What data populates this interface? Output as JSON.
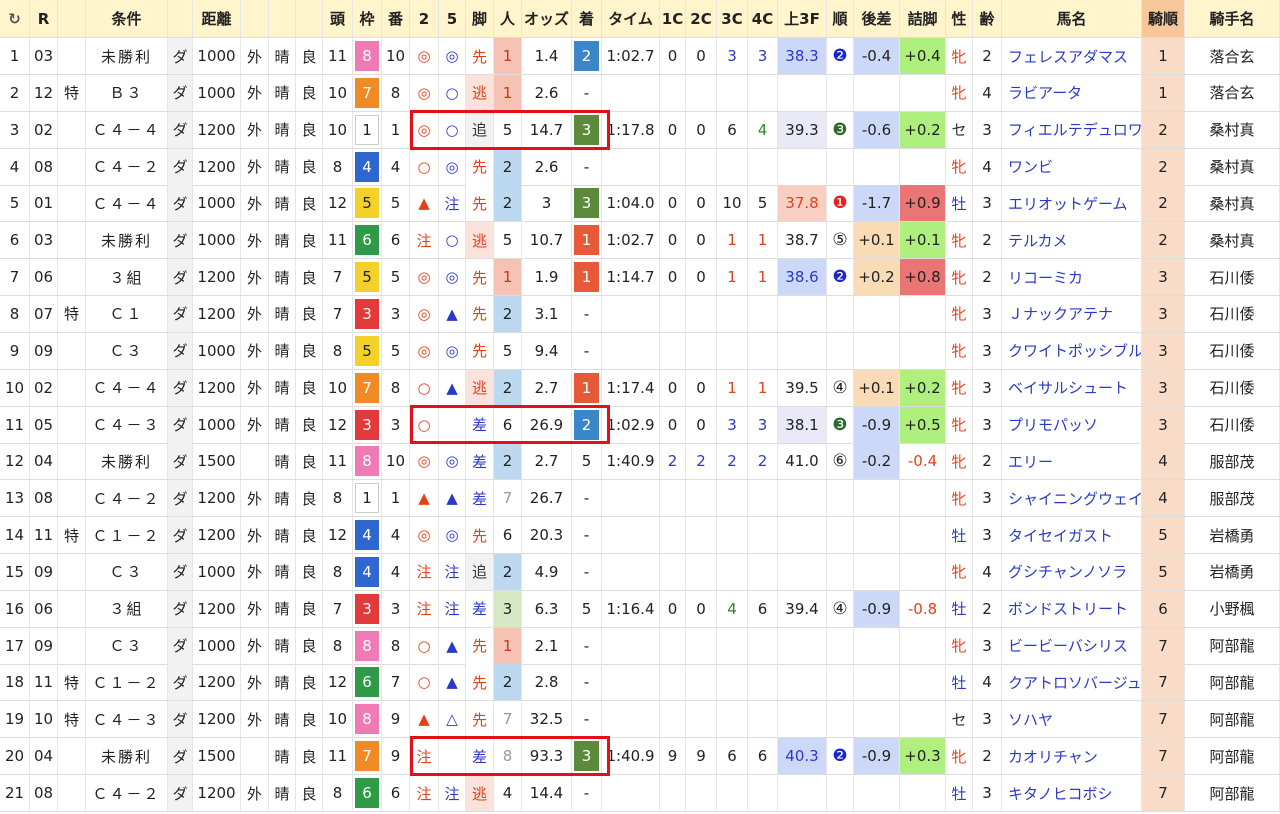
{
  "headers": {
    "refresh": "↻",
    "r": "R",
    "cond": "条件",
    "dist": "距離",
    "heads": "頭",
    "waku": "枠",
    "ban": "番",
    "m2": "2",
    "m5": "5",
    "leg": "脚",
    "pop": "人",
    "odds": "オッズ",
    "rank": "着",
    "time": "タイム",
    "c1": "1C",
    "c2": "2C",
    "c3": "3C",
    "c4": "4C",
    "last3f": "上3F",
    "order": "順",
    "diff": "後差",
    "close": "詰脚",
    "sex": "性",
    "age": "齢",
    "horse": "馬名",
    "jorder": "騎順",
    "jockey": "騎手名"
  },
  "colors": {
    "header_bg": "#fff4cc",
    "pop_1": "#f5c2b4",
    "pop_2": "#bcd9f1",
    "pop_3": "#d6e8c4",
    "rank_1": "#e65a3a",
    "rank_2": "#3a86c8",
    "rank_3": "#5a8a3a",
    "last3f_1": "#f9cfc4",
    "last3f_2": "#ccd8f7",
    "last3f_3": "#e9e9f8",
    "diff_pos": "#f9dbb6",
    "diff_neg": "#ccd8f7",
    "close_pos": "#aeef7e",
    "close_neg": "#eb7474",
    "jorder_bg": "#f9dcc8",
    "highlight": "#e3101a"
  },
  "rows": [
    {
      "no": "1",
      "r": "03",
      "sp": "",
      "cond": "未勝利",
      "surf": "ダ",
      "dist": "1000",
      "io": "外",
      "wea": "晴",
      "grd": "良",
      "heads": "11",
      "waku": "8",
      "ban": "10",
      "m2": "◎",
      "m5": "◎",
      "leg": "先",
      "pop": "1",
      "odds": "1.4",
      "rank": "2",
      "time": "1:02.7",
      "c1": "0",
      "c2": "0",
      "c3": "3",
      "c4": "3",
      "l3f": "38.3",
      "ord": "❷",
      "diff": "-0.4",
      "close": "+0.4",
      "sex": "牝",
      "age": "2",
      "horse": "フェレスアダマス",
      "jo": "1",
      "jockey": "落合玄"
    },
    {
      "no": "2",
      "r": "12",
      "sp": "特",
      "cond": "Ｂ３",
      "surf": "ダ",
      "dist": "1000",
      "io": "外",
      "wea": "晴",
      "grd": "良",
      "heads": "10",
      "waku": "7",
      "ban": "8",
      "m2": "◎",
      "m5": "○",
      "leg": "逃",
      "pop": "1",
      "odds": "2.6",
      "rank": "-",
      "time": "",
      "c1": "",
      "c2": "",
      "c3": "",
      "c4": "",
      "l3f": "",
      "ord": "",
      "diff": "",
      "close": "",
      "sex": "牝",
      "age": "4",
      "horse": "ラビアータ",
      "jo": "1",
      "jockey": "落合玄"
    },
    {
      "no": "3",
      "r": "02",
      "sp": "",
      "cond": "Ｃ４－４",
      "surf": "ダ",
      "dist": "1200",
      "io": "外",
      "wea": "晴",
      "grd": "良",
      "heads": "10",
      "waku": "1",
      "ban": "1",
      "m2": "◎",
      "m5": "○",
      "leg": "追",
      "pop": "5",
      "odds": "14.7",
      "rank": "3",
      "time": "1:17.8",
      "c1": "0",
      "c2": "0",
      "c3": "6",
      "c4": "4",
      "l3f": "39.3",
      "ord": "❸",
      "diff": "-0.6",
      "close": "+0.2",
      "sex": "セ",
      "age": "3",
      "horse": "フィエルテデュロワ",
      "jo": "2",
      "jockey": "桑村真"
    },
    {
      "no": "4",
      "r": "08",
      "sp": "",
      "cond": "Ｃ４－２",
      "surf": "ダ",
      "dist": "1200",
      "io": "外",
      "wea": "晴",
      "grd": "良",
      "heads": "8",
      "waku": "4",
      "ban": "4",
      "m2": "○",
      "m5": "◎",
      "leg": "先",
      "pop": "2",
      "odds": "2.6",
      "rank": "-",
      "time": "",
      "c1": "",
      "c2": "",
      "c3": "",
      "c4": "",
      "l3f": "",
      "ord": "",
      "diff": "",
      "close": "",
      "sex": "牝",
      "age": "4",
      "horse": "ワンビ",
      "jo": "2",
      "jockey": "桑村真"
    },
    {
      "no": "5",
      "r": "01",
      "sp": "",
      "cond": "Ｃ４－４",
      "surf": "ダ",
      "dist": "1000",
      "io": "外",
      "wea": "晴",
      "grd": "良",
      "heads": "12",
      "waku": "5",
      "ban": "5",
      "m2": "▲",
      "m5": "注",
      "leg": "先",
      "pop": "2",
      "odds": "3",
      "rank": "3",
      "time": "1:04.0",
      "c1": "0",
      "c2": "0",
      "c3": "10",
      "c4": "5",
      "l3f": "37.8",
      "ord": "❶",
      "diff": "-1.7",
      "close": "+0.9",
      "sex": "牡",
      "age": "3",
      "horse": "エリオットゲーム",
      "jo": "2",
      "jockey": "桑村真"
    },
    {
      "no": "6",
      "r": "03",
      "sp": "",
      "cond": "未勝利",
      "surf": "ダ",
      "dist": "1000",
      "io": "外",
      "wea": "晴",
      "grd": "良",
      "heads": "11",
      "waku": "6",
      "ban": "6",
      "m2": "注",
      "m5": "○",
      "leg": "逃",
      "pop": "5",
      "odds": "10.7",
      "rank": "1",
      "time": "1:02.7",
      "c1": "0",
      "c2": "0",
      "c3": "1",
      "c4": "1",
      "l3f": "38.7",
      "ord": "⑤",
      "diff": "+0.1",
      "close": "+0.1",
      "sex": "牝",
      "age": "2",
      "horse": "テルカメ",
      "jo": "2",
      "jockey": "桑村真"
    },
    {
      "no": "7",
      "r": "06",
      "sp": "",
      "cond": "３組",
      "surf": "ダ",
      "dist": "1200",
      "io": "外",
      "wea": "晴",
      "grd": "良",
      "heads": "7",
      "waku": "5",
      "ban": "5",
      "m2": "◎",
      "m5": "◎",
      "leg": "先",
      "pop": "1",
      "odds": "1.9",
      "rank": "1",
      "time": "1:14.7",
      "c1": "0",
      "c2": "0",
      "c3": "1",
      "c4": "1",
      "l3f": "38.6",
      "ord": "❷",
      "diff": "+0.2",
      "close": "+0.8",
      "sex": "牝",
      "age": "2",
      "horse": "リコーミカ",
      "jo": "3",
      "jockey": "石川倭"
    },
    {
      "no": "8",
      "r": "07",
      "sp": "特",
      "cond": "Ｃ１",
      "surf": "ダ",
      "dist": "1200",
      "io": "外",
      "wea": "晴",
      "grd": "良",
      "heads": "7",
      "waku": "3",
      "ban": "3",
      "m2": "◎",
      "m5": "▲",
      "leg": "先",
      "pop": "2",
      "odds": "3.1",
      "rank": "-",
      "time": "",
      "c1": "",
      "c2": "",
      "c3": "",
      "c4": "",
      "l3f": "",
      "ord": "",
      "diff": "",
      "close": "",
      "sex": "牝",
      "age": "3",
      "horse": "Ｊナックアテナ",
      "jo": "3",
      "jockey": "石川倭"
    },
    {
      "no": "9",
      "r": "09",
      "sp": "",
      "cond": "Ｃ３",
      "surf": "ダ",
      "dist": "1000",
      "io": "外",
      "wea": "晴",
      "grd": "良",
      "heads": "8",
      "waku": "5",
      "ban": "5",
      "m2": "◎",
      "m5": "◎",
      "leg": "先",
      "pop": "5",
      "odds": "9.4",
      "rank": "-",
      "time": "",
      "c1": "",
      "c2": "",
      "c3": "",
      "c4": "",
      "l3f": "",
      "ord": "",
      "diff": "",
      "close": "",
      "sex": "牝",
      "age": "3",
      "horse": "クワイトポッシブル",
      "jo": "3",
      "jockey": "石川倭"
    },
    {
      "no": "10",
      "r": "02",
      "sp": "",
      "cond": "Ｃ４－４",
      "surf": "ダ",
      "dist": "1200",
      "io": "外",
      "wea": "晴",
      "grd": "良",
      "heads": "10",
      "waku": "7",
      "ban": "8",
      "m2": "○",
      "m5": "▲",
      "leg": "逃",
      "pop": "2",
      "odds": "2.7",
      "rank": "1",
      "time": "1:17.4",
      "c1": "0",
      "c2": "0",
      "c3": "1",
      "c4": "1",
      "l3f": "39.5",
      "ord": "④",
      "diff": "+0.1",
      "close": "+0.2",
      "sex": "牝",
      "age": "3",
      "horse": "ベイサルシュート",
      "jo": "3",
      "jockey": "石川倭"
    },
    {
      "no": "11",
      "r": "05",
      "sp": "",
      "cond": "Ｃ４－３",
      "surf": "ダ",
      "dist": "1000",
      "io": "外",
      "wea": "晴",
      "grd": "良",
      "heads": "12",
      "waku": "3",
      "ban": "3",
      "m2": "○",
      "m5": "",
      "leg": "差",
      "pop": "6",
      "odds": "26.9",
      "rank": "2",
      "time": "1:02.9",
      "c1": "0",
      "c2": "0",
      "c3": "3",
      "c4": "3",
      "l3f": "38.1",
      "ord": "❸",
      "diff": "-0.9",
      "close": "+0.5",
      "sex": "牝",
      "age": "3",
      "horse": "プリモパッソ",
      "jo": "3",
      "jockey": "石川倭"
    },
    {
      "no": "12",
      "r": "04",
      "sp": "",
      "cond": "未勝利",
      "surf": "ダ",
      "dist": "1500",
      "io": "",
      "wea": "晴",
      "grd": "良",
      "heads": "11",
      "waku": "8",
      "ban": "10",
      "m2": "◎",
      "m5": "◎",
      "leg": "差",
      "pop": "2",
      "odds": "2.7",
      "rank": "5",
      "time": "1:40.9",
      "c1": "2",
      "c2": "2",
      "c3": "2",
      "c4": "2",
      "l3f": "41.0",
      "ord": "⑥",
      "diff": "-0.2",
      "close": "-0.4",
      "sex": "牝",
      "age": "2",
      "horse": "エリー",
      "jo": "4",
      "jockey": "服部茂"
    },
    {
      "no": "13",
      "r": "08",
      "sp": "",
      "cond": "Ｃ４－２",
      "surf": "ダ",
      "dist": "1200",
      "io": "外",
      "wea": "晴",
      "grd": "良",
      "heads": "8",
      "waku": "1",
      "ban": "1",
      "m2": "▲",
      "m5": "▲",
      "leg": "差",
      "pop": "7",
      "odds": "26.7",
      "rank": "-",
      "time": "",
      "c1": "",
      "c2": "",
      "c3": "",
      "c4": "",
      "l3f": "",
      "ord": "",
      "diff": "",
      "close": "",
      "sex": "牝",
      "age": "3",
      "horse": "シャイニングウェイ",
      "jo": "4",
      "jockey": "服部茂"
    },
    {
      "no": "14",
      "r": "11",
      "sp": "特",
      "cond": "Ｃ１－２",
      "surf": "ダ",
      "dist": "1200",
      "io": "外",
      "wea": "晴",
      "grd": "良",
      "heads": "12",
      "waku": "4",
      "ban": "4",
      "m2": "◎",
      "m5": "◎",
      "leg": "先",
      "pop": "6",
      "odds": "20.3",
      "rank": "-",
      "time": "",
      "c1": "",
      "c2": "",
      "c3": "",
      "c4": "",
      "l3f": "",
      "ord": "",
      "diff": "",
      "close": "",
      "sex": "牡",
      "age": "3",
      "horse": "タイセイガスト",
      "jo": "5",
      "jockey": "岩橋勇"
    },
    {
      "no": "15",
      "r": "09",
      "sp": "",
      "cond": "Ｃ３",
      "surf": "ダ",
      "dist": "1000",
      "io": "外",
      "wea": "晴",
      "grd": "良",
      "heads": "8",
      "waku": "4",
      "ban": "4",
      "m2": "注",
      "m5": "注",
      "leg": "追",
      "pop": "2",
      "odds": "4.9",
      "rank": "-",
      "time": "",
      "c1": "",
      "c2": "",
      "c3": "",
      "c4": "",
      "l3f": "",
      "ord": "",
      "diff": "",
      "close": "",
      "sex": "牝",
      "age": "4",
      "horse": "グシチャンノソラ",
      "jo": "5",
      "jockey": "岩橋勇"
    },
    {
      "no": "16",
      "r": "06",
      "sp": "",
      "cond": "３組",
      "surf": "ダ",
      "dist": "1200",
      "io": "外",
      "wea": "晴",
      "grd": "良",
      "heads": "7",
      "waku": "3",
      "ban": "3",
      "m2": "注",
      "m5": "注",
      "leg": "差",
      "pop": "3",
      "odds": "6.3",
      "rank": "5",
      "time": "1:16.4",
      "c1": "0",
      "c2": "0",
      "c3": "4",
      "c4": "6",
      "l3f": "39.4",
      "ord": "④",
      "diff": "-0.9",
      "close": "-0.8",
      "sex": "牡",
      "age": "2",
      "horse": "ボンドストリート",
      "jo": "6",
      "jockey": "小野楓"
    },
    {
      "no": "17",
      "r": "09",
      "sp": "",
      "cond": "Ｃ３",
      "surf": "ダ",
      "dist": "1000",
      "io": "外",
      "wea": "晴",
      "grd": "良",
      "heads": "8",
      "waku": "8",
      "ban": "8",
      "m2": "○",
      "m5": "▲",
      "leg": "先",
      "pop": "1",
      "odds": "2.1",
      "rank": "-",
      "time": "",
      "c1": "",
      "c2": "",
      "c3": "",
      "c4": "",
      "l3f": "",
      "ord": "",
      "diff": "",
      "close": "",
      "sex": "牝",
      "age": "3",
      "horse": "ビービーバシリス",
      "jo": "7",
      "jockey": "阿部龍"
    },
    {
      "no": "18",
      "r": "11",
      "sp": "特",
      "cond": "Ｃ１－２",
      "surf": "ダ",
      "dist": "1200",
      "io": "外",
      "wea": "晴",
      "grd": "良",
      "heads": "12",
      "waku": "6",
      "ban": "7",
      "m2": "○",
      "m5": "▲",
      "leg": "先",
      "pop": "2",
      "odds": "2.8",
      "rank": "-",
      "time": "",
      "c1": "",
      "c2": "",
      "c3": "",
      "c4": "",
      "l3f": "",
      "ord": "",
      "diff": "",
      "close": "",
      "sex": "牡",
      "age": "4",
      "horse": "クアトロソバージュ",
      "jo": "7",
      "jockey": "阿部龍"
    },
    {
      "no": "19",
      "r": "10",
      "sp": "特",
      "cond": "Ｃ４－３",
      "surf": "ダ",
      "dist": "1200",
      "io": "外",
      "wea": "晴",
      "grd": "良",
      "heads": "10",
      "waku": "8",
      "ban": "9",
      "m2": "▲",
      "m5": "△",
      "leg": "先",
      "pop": "7",
      "odds": "32.5",
      "rank": "-",
      "time": "",
      "c1": "",
      "c2": "",
      "c3": "",
      "c4": "",
      "l3f": "",
      "ord": "",
      "diff": "",
      "close": "",
      "sex": "セ",
      "age": "3",
      "horse": "ソハヤ",
      "jo": "7",
      "jockey": "阿部龍"
    },
    {
      "no": "20",
      "r": "04",
      "sp": "",
      "cond": "未勝利",
      "surf": "ダ",
      "dist": "1500",
      "io": "",
      "wea": "晴",
      "grd": "良",
      "heads": "11",
      "waku": "7",
      "ban": "9",
      "m2": "注",
      "m5": "",
      "leg": "差",
      "pop": "8",
      "odds": "93.3",
      "rank": "3",
      "time": "1:40.9",
      "c1": "9",
      "c2": "9",
      "c3": "6",
      "c4": "6",
      "l3f": "40.3",
      "ord": "❷",
      "diff": "-0.9",
      "close": "+0.3",
      "sex": "牝",
      "age": "2",
      "horse": "カオリチャン",
      "jo": "7",
      "jockey": "阿部龍"
    },
    {
      "no": "21",
      "r": "08",
      "sp": "",
      "cond": "Ｃ４－２",
      "surf": "ダ",
      "dist": "1200",
      "io": "外",
      "wea": "晴",
      "grd": "良",
      "heads": "8",
      "waku": "6",
      "ban": "6",
      "m2": "注",
      "m5": "注",
      "leg": "逃",
      "pop": "4",
      "odds": "14.4",
      "rank": "-",
      "time": "",
      "c1": "",
      "c2": "",
      "c3": "",
      "c4": "",
      "l3f": "",
      "ord": "",
      "diff": "",
      "close": "",
      "sex": "牡",
      "age": "3",
      "horse": "キタノヒコボシ",
      "jo": "7",
      "jockey": "阿部龍"
    }
  ]
}
